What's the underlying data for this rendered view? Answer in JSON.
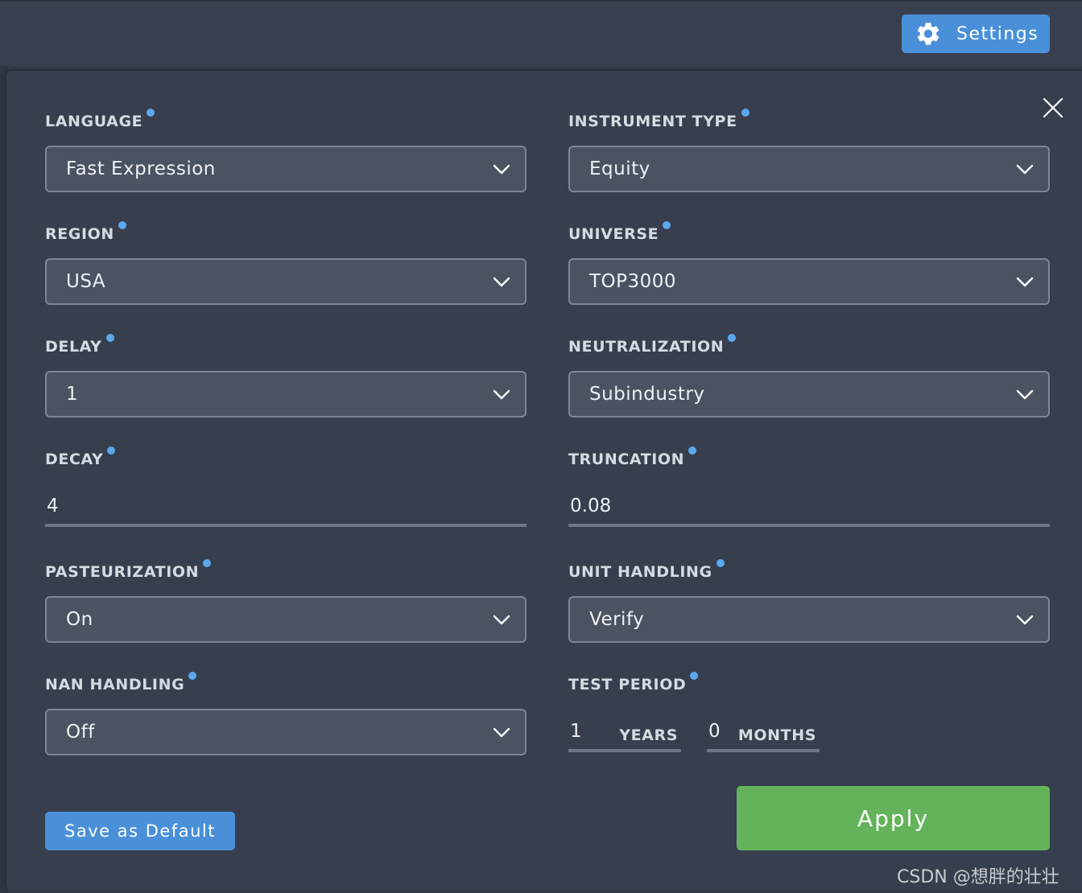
{
  "header": {
    "settings_label": "Settings",
    "settings_icon": "gear-icon"
  },
  "panel": {
    "close_icon": "close-icon"
  },
  "fields": {
    "language": {
      "label": "LANGUAGE",
      "value": "Fast Expression"
    },
    "instrument_type": {
      "label": "INSTRUMENT TYPE",
      "value": "Equity"
    },
    "region": {
      "label": "REGION",
      "value": "USA"
    },
    "universe": {
      "label": "UNIVERSE",
      "value": "TOP3000"
    },
    "delay": {
      "label": "DELAY",
      "value": "1"
    },
    "neutralization": {
      "label": "NEUTRALIZATION",
      "value": "Subindustry"
    },
    "decay": {
      "label": "DECAY",
      "value": "4"
    },
    "truncation": {
      "label": "TRUNCATION",
      "value": "0.08"
    },
    "pasteurization": {
      "label": "PASTEURIZATION",
      "value": "On"
    },
    "unit_handling": {
      "label": "UNIT HANDLING",
      "value": "Verify"
    },
    "nan_handling": {
      "label": "NAN HANDLING",
      "value": "Off"
    },
    "test_period": {
      "label": "TEST PERIOD",
      "years": "1",
      "years_unit": "YEARS",
      "months": "0",
      "months_unit": "MONTHS"
    }
  },
  "actions": {
    "save_default": "Save as Default",
    "apply": "Apply"
  },
  "colors": {
    "primary_blue": "#4a90d9",
    "apply_green": "#63b35a",
    "info_dot": "#5aa9f0",
    "panel_bg": "#373e4d"
  },
  "watermark": "CSDN @想胖的壮壮"
}
